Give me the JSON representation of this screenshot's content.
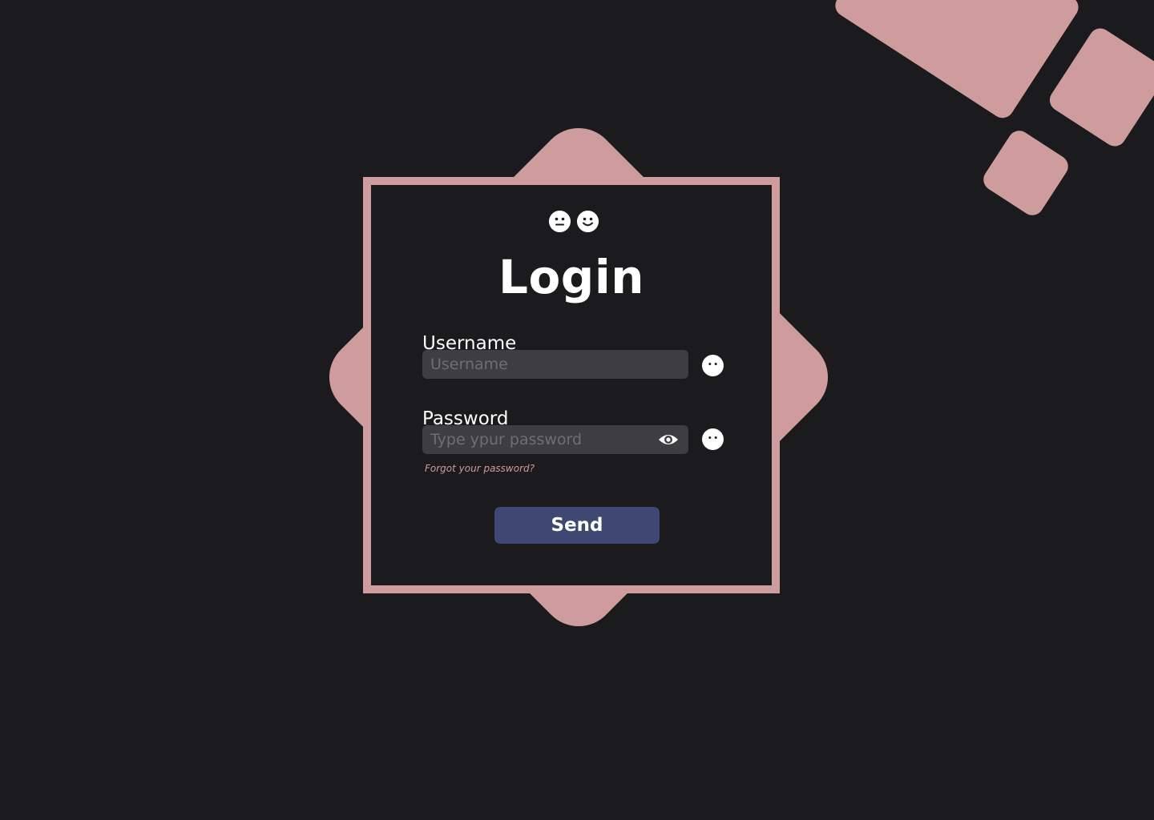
{
  "login": {
    "title": "Login",
    "username_label": "Username",
    "username_placeholder": "Username",
    "username_value": "",
    "password_label": "Password",
    "password_placeholder": "Type ypur password",
    "password_value": "",
    "forgot_link": "Forgot your password?",
    "send_label": "Send"
  },
  "icons": {
    "header_left": "neutral-face-icon",
    "header_right": "smiling-face-icon",
    "password_toggle": "eye-icon",
    "username_mascot": "face-icon",
    "password_mascot": "face-icon"
  },
  "colors": {
    "background": "#1b1a1c",
    "accent": "#cf9c9d",
    "input_bg": "#3e3d41",
    "button_bg": "#3e4870",
    "text": "#ffffff"
  }
}
